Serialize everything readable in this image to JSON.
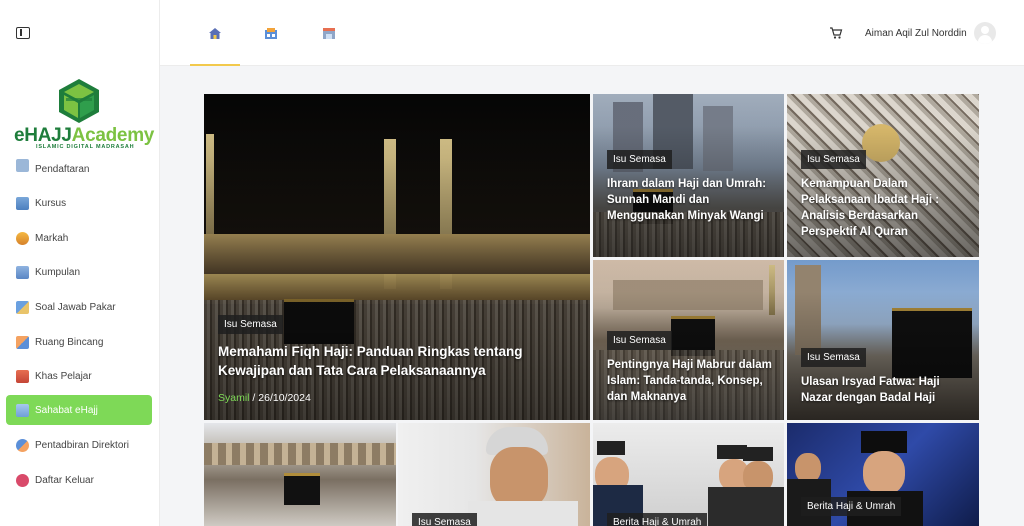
{
  "sidebar": {
    "brand": {
      "e": "e",
      "hajj": "HAJJ",
      "academy": "Academy",
      "tagline": "ISLAMIC DIGITAL MADRASAH"
    },
    "items": [
      {
        "label": "Pendaftaran",
        "icon": "document-icon",
        "active": false
      },
      {
        "label": "Kursus",
        "icon": "course-icon",
        "active": false
      },
      {
        "label": "Markah",
        "icon": "badge-icon",
        "active": false
      },
      {
        "label": "Kumpulan",
        "icon": "group-icon",
        "active": false
      },
      {
        "label": "Soal Jawab Pakar",
        "icon": "chat-icon",
        "active": false
      },
      {
        "label": "Ruang Bincang",
        "icon": "discussion-icon",
        "active": false
      },
      {
        "label": "Khas Pelajar",
        "icon": "student-icon",
        "active": false
      },
      {
        "label": "Sahabat eHajj",
        "icon": "friends-icon",
        "active": true
      },
      {
        "label": "Pentadbiran Direktori",
        "icon": "directory-icon",
        "active": false
      },
      {
        "label": "Daftar Keluar",
        "icon": "logout-icon",
        "active": false
      }
    ]
  },
  "header": {
    "tabs": [
      {
        "icon": "home-icon",
        "active": true
      },
      {
        "icon": "classroom-icon",
        "active": false
      },
      {
        "icon": "store-icon",
        "active": false
      }
    ],
    "user_name": "Aiman Aqil Zul Norddin"
  },
  "featured": {
    "badge": "Isu Semasa",
    "title": "Memahami Fiqh Haji: Panduan Ringkas tentang Kewajipan dan Tata Cara Pelaksanaannya",
    "author": "Syamil",
    "date": " / 26/10/2024"
  },
  "cards": [
    {
      "badge": "Isu Semasa",
      "title": "Ihram dalam Haji dan Umrah: Sunnah Mandi dan Menggunakan Minyak Wangi"
    },
    {
      "badge": "Isu Semasa",
      "title": "Kemampuan Dalam Pelaksanaan Ibadat Haji : Analisis Berdasarkan Perspektif Al Quran"
    },
    {
      "badge": "Isu Semasa",
      "title": "Pentingnya Haji Mabrur dalam Islam: Tanda-tanda, Konsep, dan Maknanya"
    },
    {
      "badge": "Isu Semasa",
      "title": "Ulasan Irsyad Fatwa: Haji Nazar dengan Badal Haji"
    }
  ],
  "bottom_cards": [
    {
      "badge": ""
    },
    {
      "badge": "Isu Semasa"
    },
    {
      "badge": "Berita Haji & Umrah"
    },
    {
      "badge": "Berita Haji & Umrah"
    }
  ],
  "colors": {
    "accent": "#7ed957",
    "brand_dark": "#1e7d3b",
    "tab_indicator": "#f2c94c"
  }
}
